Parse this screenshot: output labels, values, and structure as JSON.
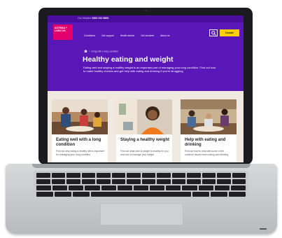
{
  "site": {
    "helpline_label": "Our helpline",
    "helpline_number": "0300 222 5800",
    "logo_text": "ASTHMA + LUNG UK",
    "nav": [
      "Conditions",
      "Get support",
      "Health advice",
      "Get involved",
      "About us"
    ],
    "search_label": "search-icon",
    "donate_label": "Donate"
  },
  "hero": {
    "breadcrumb_home": "home-icon",
    "breadcrumb": "Living with a lung condition",
    "title": "Healthy eating and weight",
    "description": "Eating well and staying a healthy weight is an important part of managing your lung condition. Find out how to make healthy choices and get help with eating and drinking if you're struggling."
  },
  "cards": [
    {
      "title": "Eating well with a long condition",
      "text": "Find out why eating a healthy diet is important for managing your lung condition."
    },
    {
      "title": "Staying a healthy weight",
      "text": "Find out what kind of weight is healthy for you and how to manage your weight."
    },
    {
      "title": "Help with eating and drinking",
      "text": "Find out how to deal with some of the common issues when eating and drinking."
    }
  ],
  "colors": {
    "brand_purple": "#5a17b8",
    "accent_pink": "#e3006d",
    "donate_yellow": "#ffd000",
    "content_bg": "#efe9e1"
  }
}
